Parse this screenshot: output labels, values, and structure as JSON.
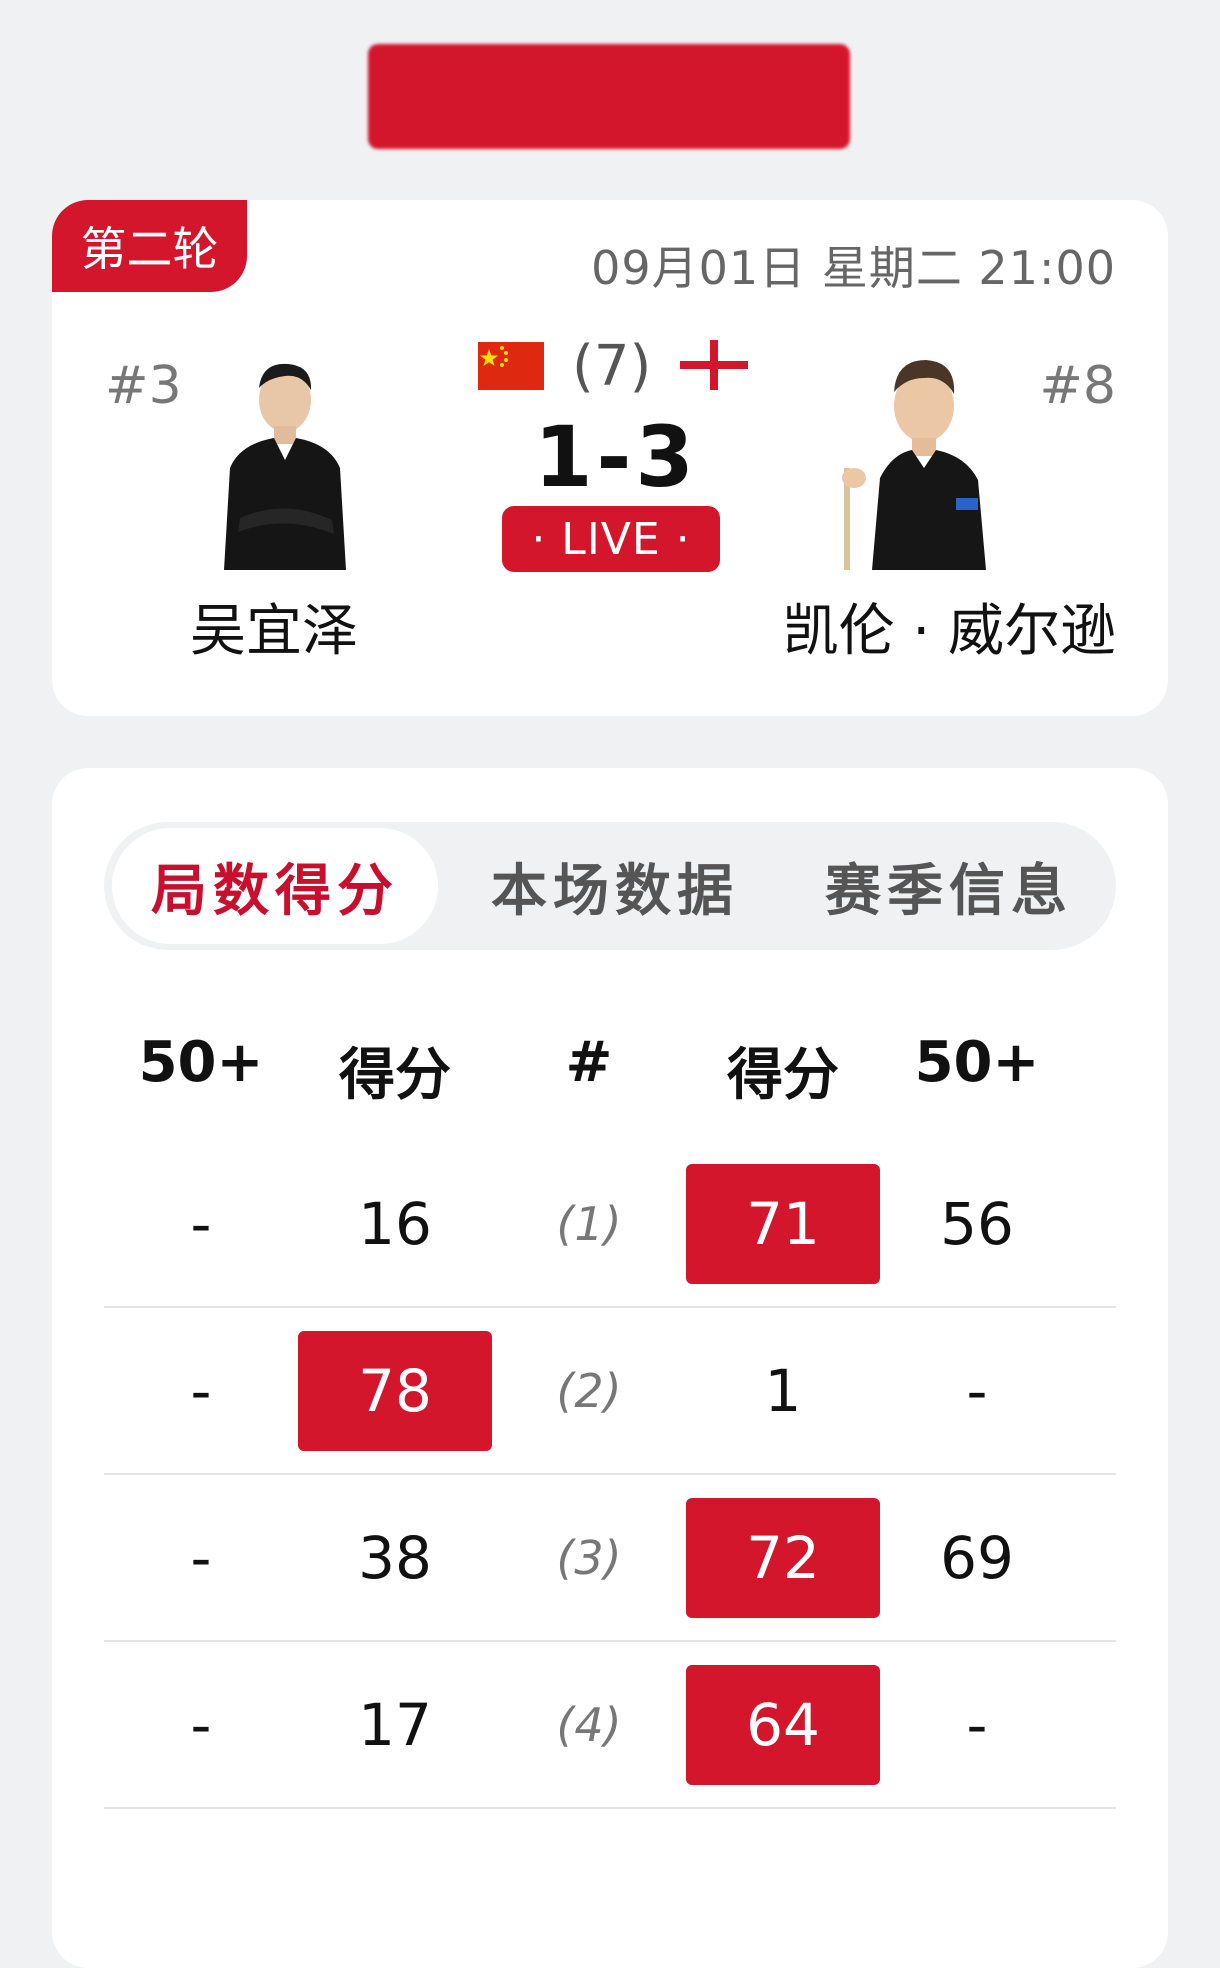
{
  "match": {
    "round": "第二轮",
    "datetime": "09月01日 星期二 21:00",
    "best_of": "(7)",
    "score": "1-3",
    "status": "· LIVE ·",
    "player_left": {
      "seed": "#3",
      "name": "吴宜泽",
      "flag": "china-flag"
    },
    "player_right": {
      "seed": "#8",
      "name": "凯伦 · 威尔逊",
      "flag": "england-flag"
    }
  },
  "tabs": [
    {
      "label": "局数得分",
      "active": true
    },
    {
      "label": "本场数据",
      "active": false
    },
    {
      "label": "赛季信息",
      "active": false
    }
  ],
  "table": {
    "headers": [
      "50+",
      "得分",
      "#",
      "得分",
      "50+"
    ],
    "rows": [
      {
        "left_50": "-",
        "left_score": "16",
        "frame": "(1)",
        "right_score": "71",
        "right_50": "56",
        "winner": "right"
      },
      {
        "left_50": "-",
        "left_score": "78",
        "frame": "(2)",
        "right_score": "1",
        "right_50": "-",
        "winner": "left"
      },
      {
        "left_50": "-",
        "left_score": "38",
        "frame": "(3)",
        "right_score": "72",
        "right_50": "69",
        "winner": "right"
      },
      {
        "left_50": "-",
        "left_score": "17",
        "frame": "(4)",
        "right_score": "64",
        "right_50": "-",
        "winner": "right"
      }
    ]
  },
  "colors": {
    "accent": "#d3162c",
    "background": "#f0f1f3",
    "card": "#ffffff"
  }
}
